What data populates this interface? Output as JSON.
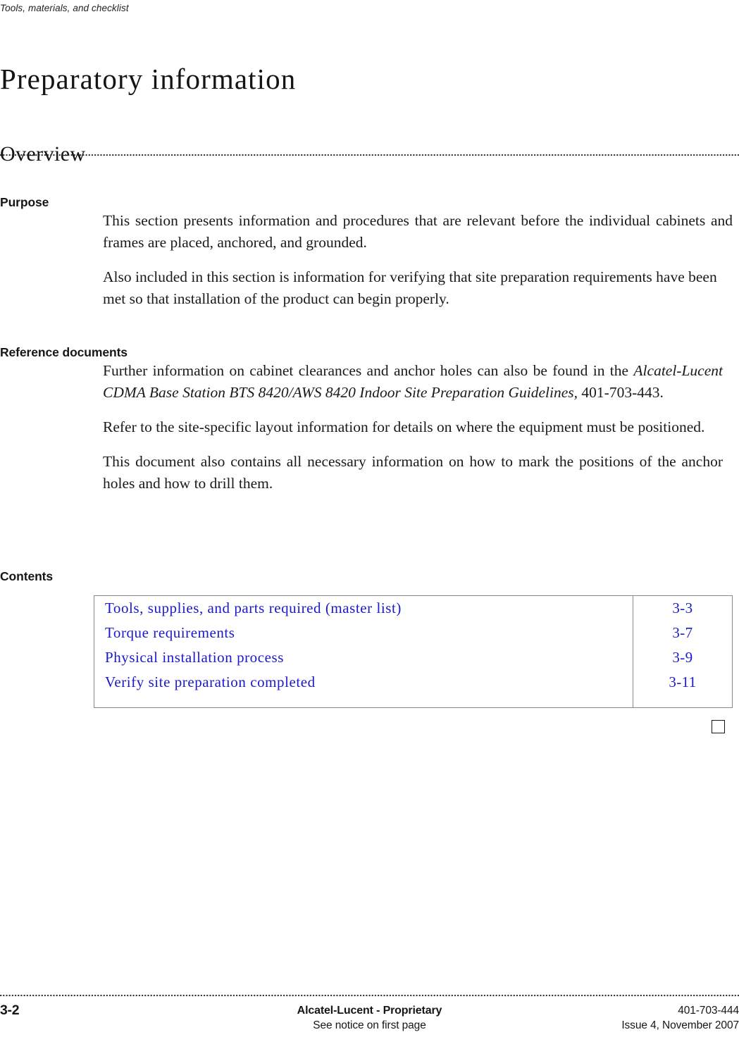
{
  "header": {
    "running_head": "Tools, materials, and checklist"
  },
  "title": {
    "chapter_title": "Preparatory information"
  },
  "section": {
    "heading": "Overview"
  },
  "purpose": {
    "heading": "Purpose",
    "paragraphs": [
      "This section presents information and procedures that are relevant before the individual cabinets and frames are placed, anchored, and grounded.",
      "Also included in this section is information for verifying that site preparation requirements have been met so that installation of the product can begin properly."
    ]
  },
  "reference": {
    "heading": "Reference documents",
    "para1_lead": "Further information on cabinet clearances and anchor holes can also be found in the ",
    "para1_doc_title": "Alcatel-Lucent CDMA Base Station BTS 8420/AWS 8420 Indoor Site Preparation Guidelines,",
    "para1_tail": " 401-703-443.",
    "para2": "Refer to the site-specific layout information for details on where the equipment must be positioned.",
    "para3": "This document also contains all necessary information on how to mark the positions of the anchor holes and how to drill them."
  },
  "contents": {
    "heading": "Contents",
    "link_color": "#1a1acc",
    "rows": [
      {
        "label": "Tools, supplies, and parts required (master list)",
        "page": "3-3"
      },
      {
        "label": "Torque requirements",
        "page": "3-7"
      },
      {
        "label": "Physical installation process",
        "page": "3-9"
      },
      {
        "label": "Verify site preparation completed",
        "page": "3-11"
      }
    ]
  },
  "footer": {
    "page_number": "3-2",
    "center_line1": "Alcatel-Lucent - Proprietary",
    "center_line2": "See notice on first page",
    "right_line1": "401-703-444",
    "right_line2": "Issue 4, November 2007"
  }
}
